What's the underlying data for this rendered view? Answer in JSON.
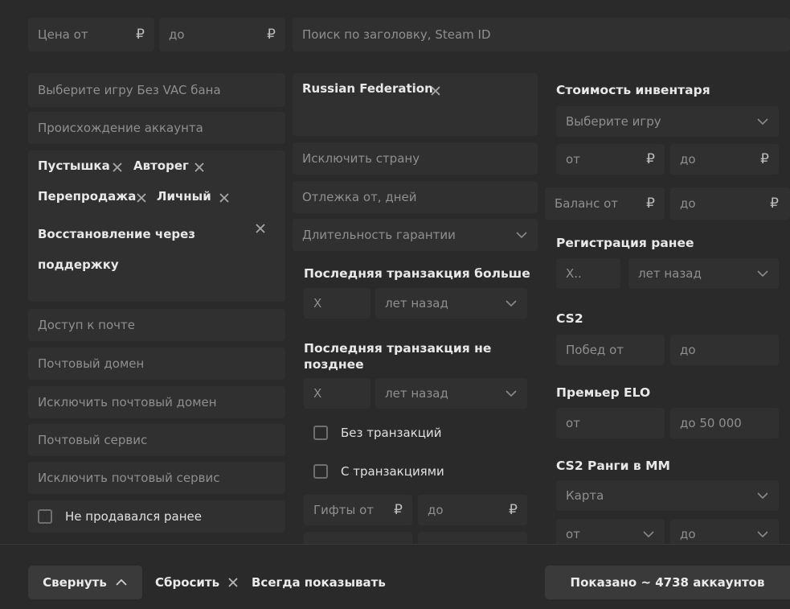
{
  "top": {
    "price_from_placeholder": "Цена от",
    "price_to_placeholder": "до",
    "currency": "₽",
    "search_placeholder": "Поиск по заголовку, Steam ID"
  },
  "left": {
    "vac_placeholder": "Выберите игру Без VAC бана",
    "origin_placeholder": "Происхождение аккаунта",
    "origin_tags": [
      "Пустышка",
      "Авторег",
      "Перепродажа",
      "Личный",
      "Восстановление через поддержку"
    ],
    "mail_access": "Доступ к почте",
    "mail_domain": "Почтовый домен",
    "exclude_mail_domain": "Исключить почтовый домен",
    "mail_service": "Почтовый сервис",
    "exclude_mail_service": "Исключить почтовый сервис",
    "not_sold_before": "Не продавался ранее"
  },
  "middle": {
    "country_tag": "Russian Federation",
    "exclude_country": "Исключить страну",
    "hold_days": "Отлежка от, дней",
    "warranty": "Длительность гарантии",
    "last_tx_more_title": "Последняя транзакция больше",
    "last_tx_more_value": "X",
    "years_ago": "лет назад",
    "last_tx_not_later_title": "Последняя транзакция не позднее",
    "last_tx_not_later_value": "X",
    "no_transactions": "Без транзакций",
    "with_transactions": "С транзакциями",
    "gifts_from": "Гифты от",
    "gifts_to": "до"
  },
  "right": {
    "inventory_title": "Стоимость инвентаря",
    "select_game": "Выберите игру",
    "from": "от",
    "to": "до",
    "balance_from": "Баланс от",
    "reg_title": "Регистрация ранее",
    "reg_value": "X..",
    "years_ago": "лет назад",
    "cs2_title": "CS2",
    "wins_from": "Побед от",
    "premier_title": "Премьер ELO",
    "premier_to": "до 50 000",
    "ranks_title": "CS2 Ранги в MM",
    "map": "Карта"
  },
  "bottom": {
    "collapse": "Свернуть",
    "reset": "Сбросить",
    "always_show": "Всегда показывать",
    "shown": "Показано ~ 4738 аккаунтов"
  }
}
